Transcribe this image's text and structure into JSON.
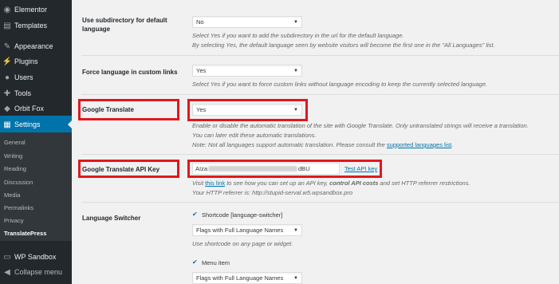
{
  "sidebar": {
    "items": [
      {
        "label": "Elementor",
        "icon": "elementor-icon"
      },
      {
        "label": "Templates",
        "icon": "folder-icon"
      },
      {
        "label": "Appearance",
        "icon": "paintbrush-icon"
      },
      {
        "label": "Plugins",
        "icon": "plug-icon"
      },
      {
        "label": "Users",
        "icon": "users-icon"
      },
      {
        "label": "Tools",
        "icon": "wrench-icon"
      },
      {
        "label": "Orbit Fox",
        "icon": "fox-icon"
      },
      {
        "label": "Settings",
        "icon": "settings-icon"
      },
      {
        "label": "WP Sandbox",
        "icon": "sandbox-icon"
      },
      {
        "label": "Collapse menu",
        "icon": "collapse-icon"
      }
    ],
    "submenu": [
      "General",
      "Writing",
      "Reading",
      "Discussion",
      "Media",
      "Permalinks",
      "Privacy",
      "TranslatePress"
    ],
    "active_item": "Settings",
    "current_submenu": "TranslatePress"
  },
  "settings": {
    "subdirectory": {
      "label": "Use subdirectory for default language",
      "value": "No",
      "desc1": "Select Yes if you want to add the subdirectory in the url for the default language.",
      "desc2": "By selecting Yes, the default language seen by website visitors will become the first one in the \"All Languages\" list."
    },
    "force_language": {
      "label": "Force language in custom links",
      "value": "Yes",
      "desc1": "Select Yes if you want to force custom links without language encoding to keep the currently selected language."
    },
    "google_translate": {
      "label": "Google Translate",
      "value": "Yes",
      "desc1": "Enable or disable the automatic translation of the site with Google Translate. Only untranslated strings will receive a translation.",
      "desc2": "You can later edit these automatic translations.",
      "desc3_prefix": "Note: Not all languages support automatic translation. Please consult the ",
      "desc3_link": "supported languages list",
      "desc3_suffix": "."
    },
    "api_key": {
      "label": "Google Translate API Key",
      "value_start": "AIza",
      "value_end": "dBU",
      "test_link": "Test API key",
      "desc1_prefix": "Visit ",
      "desc1_link": "this link",
      "desc1_mid": " to see how you can set up an API key, ",
      "desc1_bold": "control API costs",
      "desc1_suffix": " and set HTTP referrer restrictions.",
      "desc2": "Your HTTP referrer is: http://stupid-serval.w5.wpsandbox.pro"
    },
    "language_switcher": {
      "label": "Language Switcher",
      "shortcode_label": "Shortcode [language-switcher]",
      "shortcode_value": "Flags with Full Language Names",
      "shortcode_desc": "Use shortcode on any page or widget.",
      "menu_label": "Menu item",
      "menu_value": "Flags with Full Language Names"
    }
  },
  "colors": {
    "highlight": "#e0181d",
    "accent": "#0073aa",
    "sidebar": "#23282d"
  }
}
